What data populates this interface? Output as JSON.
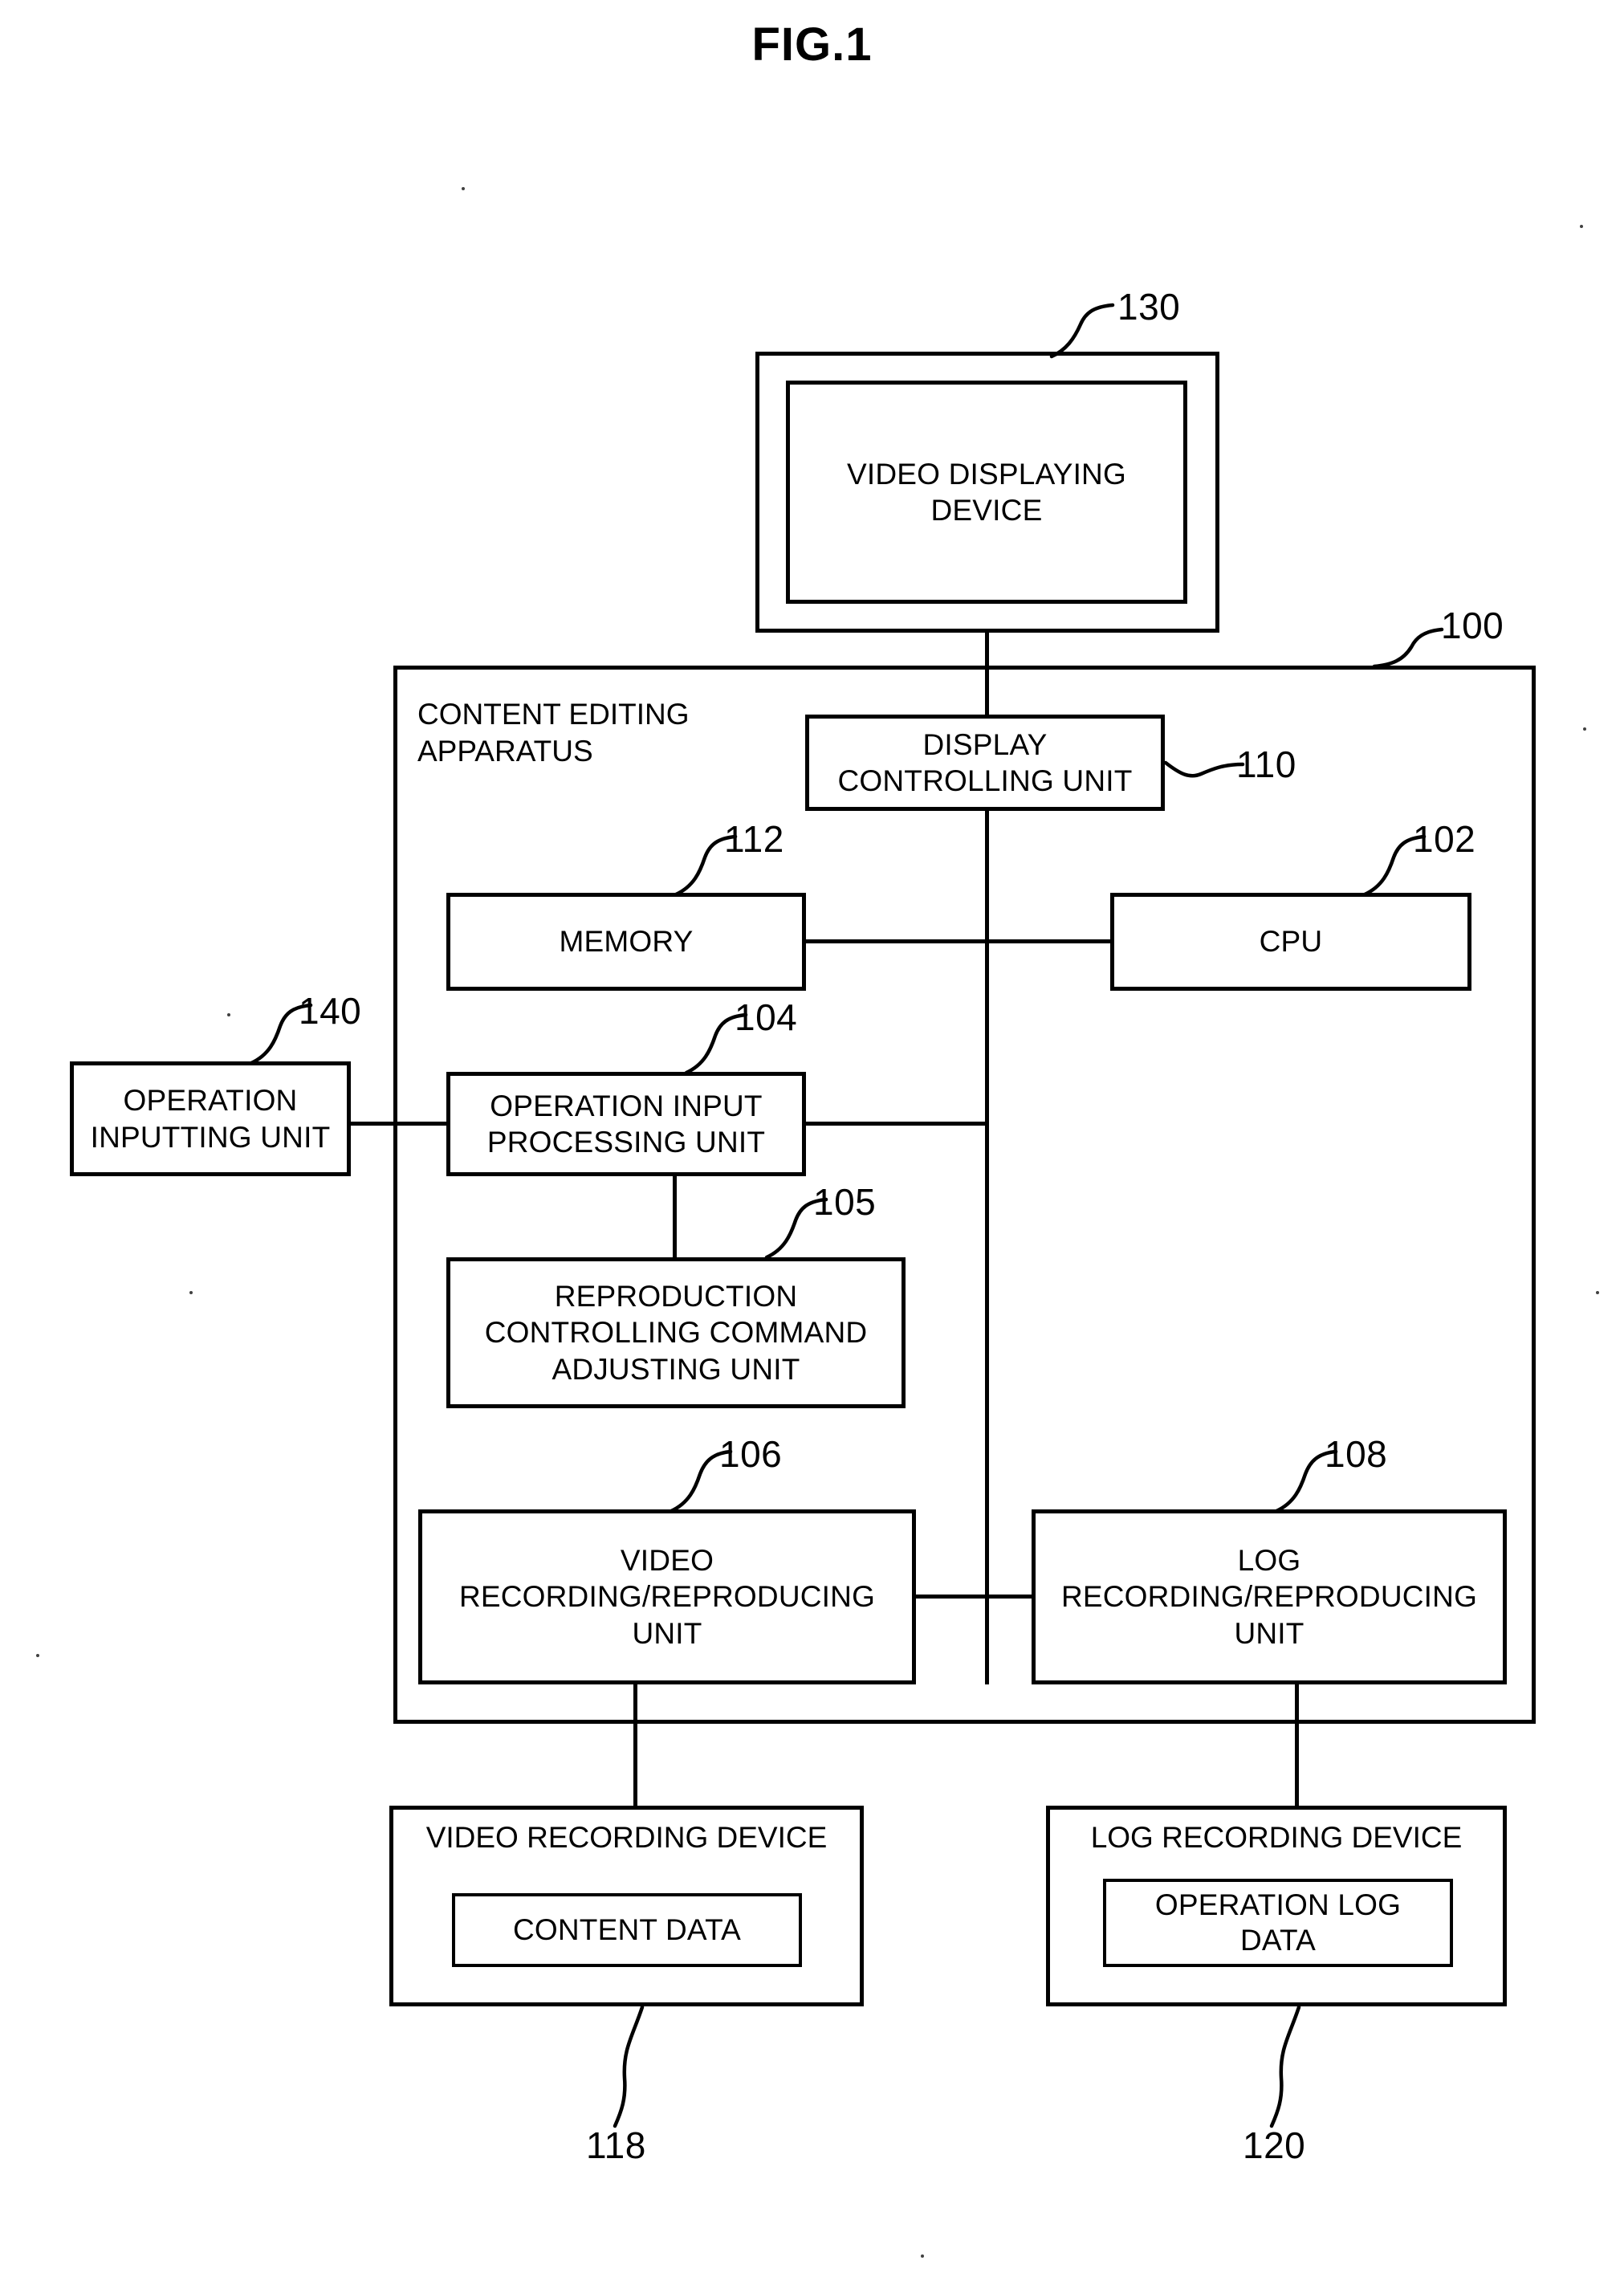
{
  "figure": {
    "title": "FIG.1",
    "type": "patent-block-diagram"
  },
  "blocks": {
    "video_displaying_device": {
      "label": "VIDEO DISPLAYING\nDEVICE",
      "ref": "130"
    },
    "content_editing_apparatus": {
      "label": "CONTENT EDITING\nAPPARATUS",
      "ref": "100"
    },
    "display_controlling_unit": {
      "label": "DISPLAY\nCONTROLLING UNIT",
      "ref": "110"
    },
    "memory": {
      "label": "MEMORY",
      "ref": "112"
    },
    "cpu": {
      "label": "CPU",
      "ref": "102"
    },
    "operation_inputting_unit": {
      "label": "OPERATION\nINPUTTING UNIT",
      "ref": "140"
    },
    "operation_input_processing_unit": {
      "label": "OPERATION INPUT\nPROCESSING UNIT",
      "ref": "104"
    },
    "reproduction_controlling_command_adjusting_unit": {
      "label": "REPRODUCTION\nCONTROLLING COMMAND\nADJUSTING UNIT",
      "ref": "105"
    },
    "video_recording_reproducing_unit": {
      "label": "VIDEO\nRECORDING/REPRODUCING\nUNIT",
      "ref": "106"
    },
    "log_recording_reproducing_unit": {
      "label": "LOG\nRECORDING/REPRODUCING\nUNIT",
      "ref": "108"
    },
    "video_recording_device": {
      "label": "VIDEO RECORDING DEVICE",
      "ref": "118",
      "content_box": "CONTENT DATA"
    },
    "log_recording_device": {
      "label": "LOG RECORDING DEVICE",
      "ref": "120",
      "content_box": "OPERATION LOG\nDATA"
    }
  },
  "colors": {
    "ink": "#000000",
    "paper": "#ffffff"
  }
}
